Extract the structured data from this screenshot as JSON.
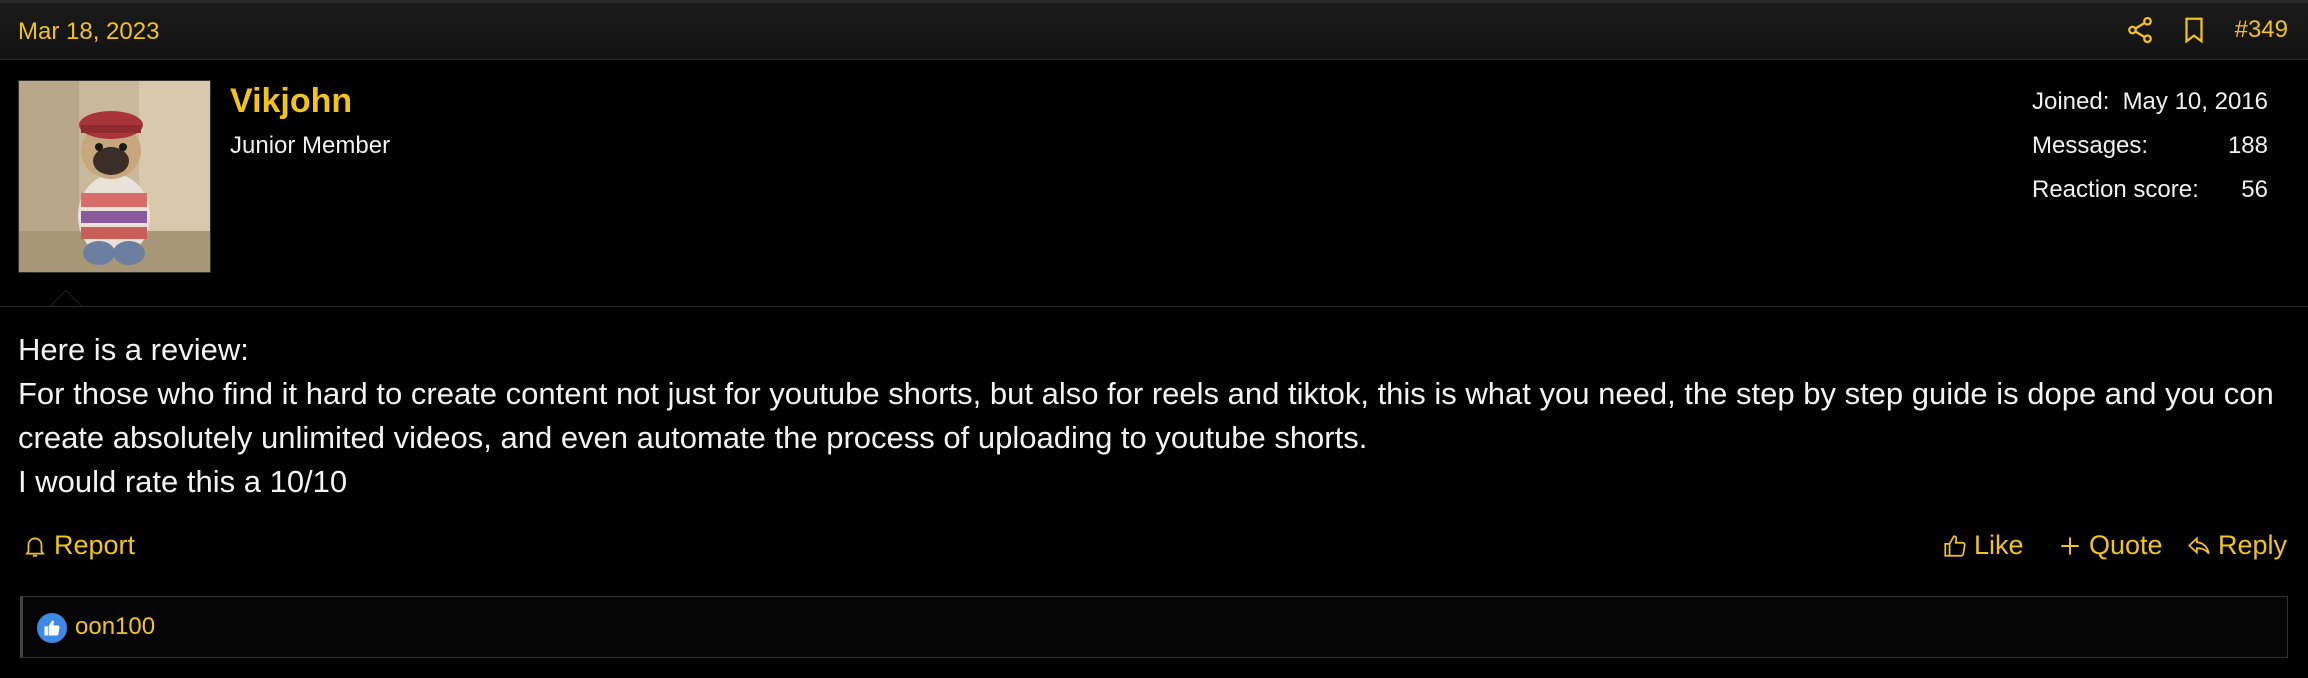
{
  "post": {
    "date": "Mar 18, 2023",
    "number": "#349",
    "icons": {
      "share": "share-icon",
      "bookmark": "bookmark-icon"
    }
  },
  "user": {
    "name": "Vikjohn",
    "title": "Junior Member",
    "stats": [
      {
        "label": "Joined:",
        "value": "May 10, 2016"
      },
      {
        "label": "Messages:",
        "value": "188"
      },
      {
        "label": "Reaction score:",
        "value": "56"
      }
    ]
  },
  "message": {
    "lines": [
      "Here is a review:",
      "For those who find it hard to create content not just for youtube shorts, but also for reels and tiktok, this is what you need, the step by step guide is dope and you con create absolutely unlimited videos, and even automate the process of uploading to youtube shorts.",
      "I would rate this a 10/10"
    ]
  },
  "actions": {
    "report": "Report",
    "like": "Like",
    "quote": "Quote",
    "reply": "Reply"
  },
  "reactions": {
    "icon": "thumbs-up-icon",
    "users": "oon100"
  },
  "colors": {
    "accent": "#f2c318",
    "background": "#000000",
    "like_badge": "#3d8ae6"
  }
}
